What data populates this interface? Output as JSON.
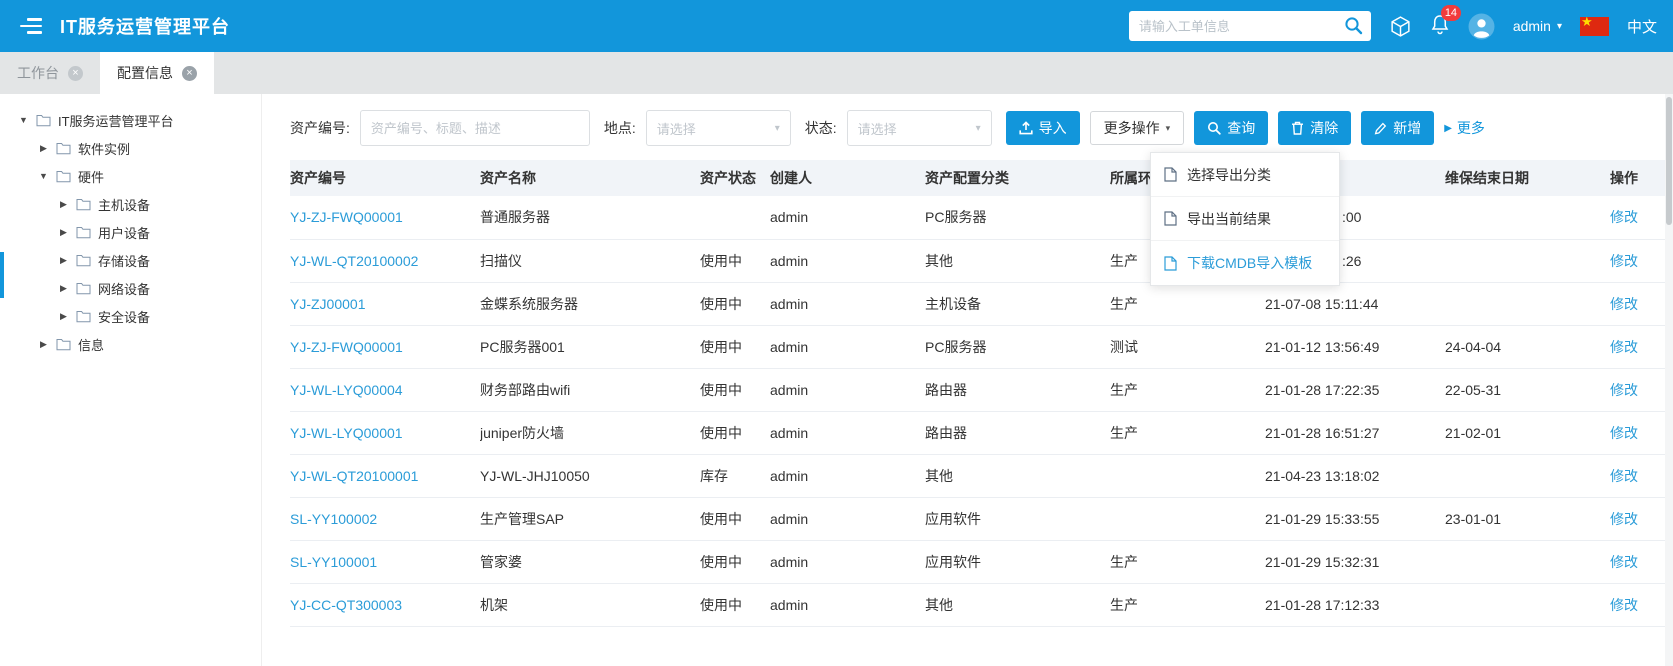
{
  "colors": {
    "accent": "#1296db",
    "link": "#2b9cd8",
    "badge_red": "#f23c3c",
    "flag_red": "#de2910",
    "flag_yellow": "#ffde00"
  },
  "icons": {
    "caret_down": "▾",
    "triangle_right": "▶",
    "triangle_down": "▼",
    "close": "×",
    "star": "★"
  },
  "header": {
    "title": "IT服务运营管理平台",
    "search_placeholder": "请输入工单信息",
    "notification_count": "14",
    "username": "admin",
    "language": "中文"
  },
  "tabs": [
    {
      "label": "工作台",
      "active": false
    },
    {
      "label": "配置信息",
      "active": true
    }
  ],
  "sidebar": {
    "tree": [
      {
        "label": "IT服务运营管理平台",
        "level": 0,
        "expanded": true
      },
      {
        "label": "软件实例",
        "level": 1,
        "expanded": false
      },
      {
        "label": "硬件",
        "level": 1,
        "expanded": true
      },
      {
        "label": "主机设备",
        "level": 2,
        "expanded": false
      },
      {
        "label": "用户设备",
        "level": 2,
        "expanded": false
      },
      {
        "label": "存储设备",
        "level": 2,
        "expanded": false
      },
      {
        "label": "网络设备",
        "level": 2,
        "expanded": false
      },
      {
        "label": "安全设备",
        "level": 2,
        "expanded": false
      },
      {
        "label": "信息",
        "level": 1,
        "expanded": false
      }
    ]
  },
  "filters": {
    "asset_no_label": "资产编号:",
    "asset_no_placeholder": "资产编号、标题、描述",
    "location_label": "地点:",
    "location_value": "请选择",
    "status_label": "状态:",
    "status_value": "请选择"
  },
  "toolbar": {
    "import_label": "导入",
    "more_actions_label": "更多操作",
    "query_label": "查询",
    "clear_label": "清除",
    "add_label": "新增",
    "more_label": "更多"
  },
  "dropdown": {
    "items": [
      {
        "label": "选择导出分类",
        "highlighted": false
      },
      {
        "label": "导出当前结果",
        "highlighted": false
      },
      {
        "label": "下载CMDB导入模板",
        "highlighted": true
      }
    ]
  },
  "table": {
    "headers": [
      "资产编号",
      "资产名称",
      "资产状态",
      "创建人",
      "资产配置分类",
      "所属环境",
      "",
      "维保结束日期",
      "操作"
    ],
    "rows": [
      {
        "asset_no": "YJ-ZJ-FWQ00001",
        "name": "普通服务器",
        "status": "",
        "creator": "admin",
        "category": "PC服务器",
        "env": "",
        "date": ":00",
        "warranty_end": "",
        "action": "修改"
      },
      {
        "asset_no": "YJ-WL-QT20100002",
        "name": "扫描仪",
        "status": "使用中",
        "creator": "admin",
        "category": "其他",
        "env": "生产",
        "date": ":26",
        "warranty_end": "",
        "action": "修改"
      },
      {
        "asset_no": "YJ-ZJ00001",
        "name": "金蝶系统服务器",
        "status": "使用中",
        "creator": "admin",
        "category": "主机设备",
        "env": "生产",
        "date": "21-07-08 15:11:44",
        "warranty_end": "",
        "action": "修改"
      },
      {
        "asset_no": "YJ-ZJ-FWQ00001",
        "name": "PC服务器001",
        "status": "使用中",
        "creator": "admin",
        "category": "PC服务器",
        "env": "测试",
        "date": "21-01-12 13:56:49",
        "warranty_end": "24-04-04",
        "action": "修改"
      },
      {
        "asset_no": "YJ-WL-LYQ00004",
        "name": "财务部路由wifi",
        "status": "使用中",
        "creator": "admin",
        "category": "路由器",
        "env": "生产",
        "date": "21-01-28 17:22:35",
        "warranty_end": "22-05-31",
        "action": "修改"
      },
      {
        "asset_no": "YJ-WL-LYQ00001",
        "name": "juniper防火墙",
        "status": "使用中",
        "creator": "admin",
        "category": "路由器",
        "env": "生产",
        "date": "21-01-28 16:51:27",
        "warranty_end": "21-02-01",
        "action": "修改"
      },
      {
        "asset_no": "YJ-WL-QT20100001",
        "name": "YJ-WL-JHJ10050",
        "status": "库存",
        "creator": "admin",
        "category": "其他",
        "env": "",
        "date": "21-04-23 13:18:02",
        "warranty_end": "",
        "action": "修改"
      },
      {
        "asset_no": "SL-YY100002",
        "name": "生产管理SAP",
        "status": "使用中",
        "creator": "admin",
        "category": "应用软件",
        "env": "",
        "date": "21-01-29 15:33:55",
        "warranty_end": "23-01-01",
        "action": "修改"
      },
      {
        "asset_no": "SL-YY100001",
        "name": "管家婆",
        "status": "使用中",
        "creator": "admin",
        "category": "应用软件",
        "env": "生产",
        "date": "21-01-29 15:32:31",
        "warranty_end": "",
        "action": "修改"
      },
      {
        "asset_no": "YJ-CC-QT300003",
        "name": "机架",
        "status": "使用中",
        "creator": "admin",
        "category": "其他",
        "env": "生产",
        "date": "21-01-28 17:12:33",
        "warranty_end": "",
        "action": "修改"
      }
    ]
  }
}
